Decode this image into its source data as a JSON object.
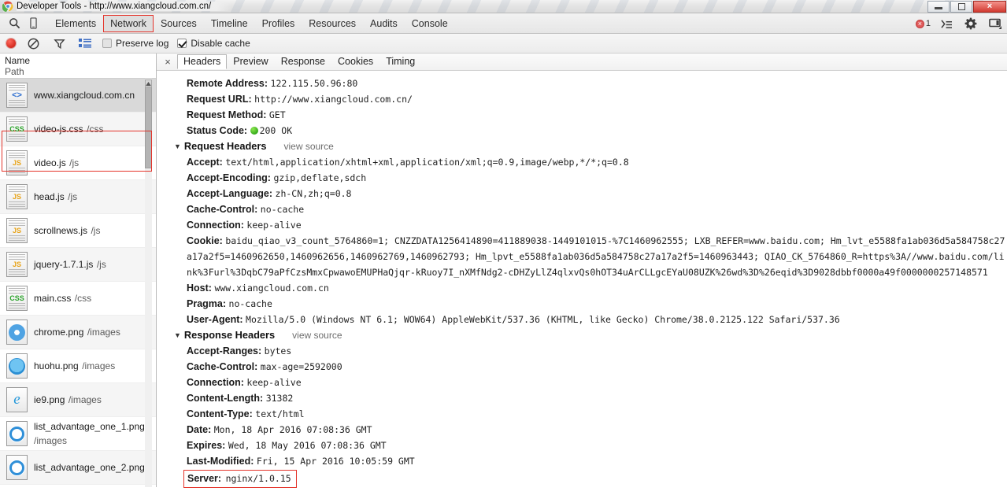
{
  "window": {
    "title": "Developer Tools - http://www.xiangcloud.com.cn/",
    "icon": "chrome-icon",
    "buttons": {
      "minimize": "minimize-icon",
      "maximize": "maximize-icon",
      "close": "×"
    }
  },
  "devtools": {
    "left_icons": [
      "inspect-element-icon",
      "device-mode-icon"
    ],
    "panels": [
      {
        "label": "Elements",
        "active": false
      },
      {
        "label": "Network",
        "active": true
      },
      {
        "label": "Sources",
        "active": false
      },
      {
        "label": "Timeline",
        "active": false
      },
      {
        "label": "Profiles",
        "active": false
      },
      {
        "label": "Resources",
        "active": false
      },
      {
        "label": "Audits",
        "active": false
      },
      {
        "label": "Console",
        "active": false
      }
    ],
    "right": {
      "error_count": "1",
      "icons": [
        "console-drawer-icon",
        "settings-gear-icon",
        "dock-side-icon"
      ]
    }
  },
  "network_toolbar": {
    "record_label": "record-button",
    "clear_label": "clear-button",
    "filter_label": "filter-button",
    "view_label": "large-rows-button",
    "preserve_log": {
      "label": "Preserve log",
      "checked": false
    },
    "disable_cache": {
      "label": "Disable cache",
      "checked": true
    }
  },
  "sidebar": {
    "columns": {
      "name": "Name",
      "path": "Path"
    },
    "files": [
      {
        "name": "www.xiangcloud.com.cn",
        "path": "",
        "icon": "document-code-icon",
        "selected": true
      },
      {
        "name": "video-js.css",
        "path": "/css",
        "icon": "css-file-icon",
        "selected": false
      },
      {
        "name": "video.js",
        "path": "/js",
        "icon": "js-file-icon",
        "selected": false
      },
      {
        "name": "head.js",
        "path": "/js",
        "icon": "js-file-icon",
        "selected": false
      },
      {
        "name": "scrollnews.js",
        "path": "/js",
        "icon": "js-file-icon",
        "selected": false
      },
      {
        "name": "jquery-1.7.1.js",
        "path": "/js",
        "icon": "js-file-icon",
        "selected": false
      },
      {
        "name": "main.css",
        "path": "/css",
        "icon": "css-file-icon",
        "selected": false
      },
      {
        "name": "chrome.png",
        "path": "/images",
        "icon": "image-chrome-icon",
        "selected": false
      },
      {
        "name": "huohu.png",
        "path": "/images",
        "icon": "image-firefox-icon",
        "selected": false
      },
      {
        "name": "ie9.png",
        "path": "/images",
        "icon": "image-ie-icon",
        "selected": false
      },
      {
        "name": "list_advantage_one_1.png",
        "path": "/images",
        "icon": "image-dot-icon",
        "selected": false
      },
      {
        "name": "list_advantage_one_2.png",
        "path": "",
        "icon": "image-dot-icon",
        "selected": false
      }
    ]
  },
  "details": {
    "close_label": "×",
    "tabs": [
      {
        "label": "Headers",
        "active": true
      },
      {
        "label": "Preview",
        "active": false
      },
      {
        "label": "Response",
        "active": false
      },
      {
        "label": "Cookies",
        "active": false
      },
      {
        "label": "Timing",
        "active": false
      }
    ],
    "general": [
      {
        "key": "Remote Address:",
        "value": "122.115.50.96:80"
      },
      {
        "key": "Request URL:",
        "value": "http://www.xiangcloud.com.cn/"
      },
      {
        "key": "Request Method:",
        "value": "GET"
      }
    ],
    "status": {
      "key": "Status Code:",
      "value": "200  OK"
    },
    "request_headers": {
      "title": "Request Headers",
      "view_source": "view source",
      "items": [
        {
          "key": "Accept:",
          "value": "text/html,application/xhtml+xml,application/xml;q=0.9,image/webp,*/*;q=0.8"
        },
        {
          "key": "Accept-Encoding:",
          "value": "gzip,deflate,sdch"
        },
        {
          "key": "Accept-Language:",
          "value": "zh-CN,zh;q=0.8"
        },
        {
          "key": "Cache-Control:",
          "value": "no-cache"
        },
        {
          "key": "Connection:",
          "value": "keep-alive"
        },
        {
          "key": "Cookie:",
          "value": "baidu_qiao_v3_count_5764860=1; CNZZDATA1256414890=411889038-1449101015-%7C1460962555; LXB_REFER=www.baidu.com; Hm_lvt_e5588fa1ab036d5a584758c27a17a2f5=1460962650,1460962656,1460962769,1460962793; Hm_lpvt_e5588fa1ab036d5a584758c27a17a2f5=1460963443; QIAO_CK_5764860_R=https%3A//www.baidu.com/link%3Furl%3DqbC79aPfCzsMmxCpwawoEMUPHaQjqr-kRuoy7I_nXMfNdg2-cDHZyLlZ4qlxvQs0hOT34uArCLLgcEYaU08UZK%26wd%3D%26eqid%3D9028dbbf0000a49f0000000257148571"
        },
        {
          "key": "Host:",
          "value": "www.xiangcloud.com.cn"
        },
        {
          "key": "Pragma:",
          "value": "no-cache"
        },
        {
          "key": "User-Agent:",
          "value": "Mozilla/5.0 (Windows NT 6.1; WOW64) AppleWebKit/537.36 (KHTML, like Gecko) Chrome/38.0.2125.122 Safari/537.36"
        }
      ]
    },
    "response_headers": {
      "title": "Response Headers",
      "view_source": "view source",
      "items": [
        {
          "key": "Accept-Ranges:",
          "value": "bytes"
        },
        {
          "key": "Cache-Control:",
          "value": "max-age=2592000"
        },
        {
          "key": "Connection:",
          "value": "keep-alive"
        },
        {
          "key": "Content-Length:",
          "value": "31382"
        },
        {
          "key": "Content-Type:",
          "value": "text/html"
        },
        {
          "key": "Date:",
          "value": "Mon, 18 Apr 2016 07:08:36 GMT"
        },
        {
          "key": "Expires:",
          "value": "Wed, 18 May 2016 07:08:36 GMT"
        },
        {
          "key": "Last-Modified:",
          "value": "Fri, 15 Apr 2016 10:05:59 GMT"
        }
      ],
      "highlighted": {
        "key": "Server:",
        "value": "nginx/1.0.15"
      }
    }
  },
  "colors": {
    "highlight_red": "#e4342b",
    "status_green": "#2ea516",
    "record_red": "#d42b20"
  }
}
